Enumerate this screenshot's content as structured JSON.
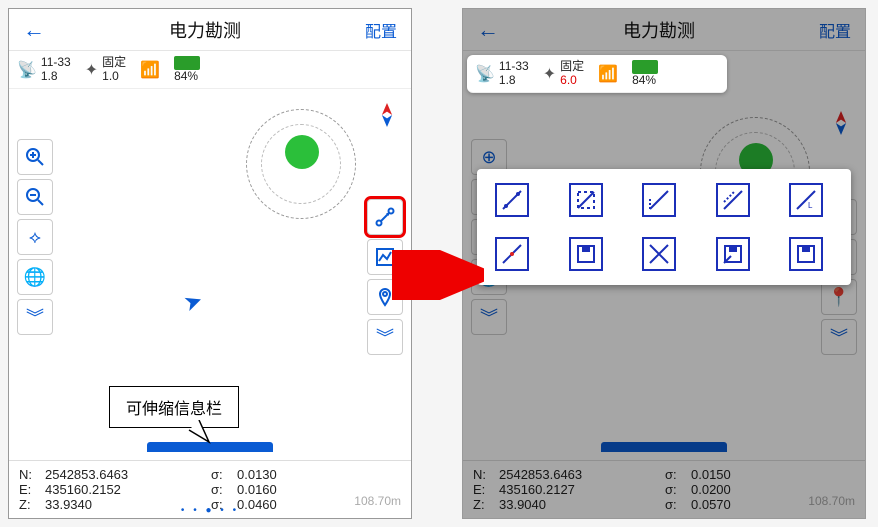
{
  "left": {
    "header": {
      "back": "←",
      "title": "电力勘测",
      "config": "配置"
    },
    "status": {
      "sat": {
        "top": "11-33",
        "bottom": "1.8"
      },
      "fix": {
        "label": "固定",
        "value": "1.0"
      },
      "batt": {
        "pct": "84%"
      }
    },
    "coords": {
      "N": "2542853.6463",
      "E": "435160.2152",
      "Z": "33.9340",
      "sN": "0.0130",
      "sE": "0.0160",
      "sZ": "0.0460"
    },
    "dist": "108.70m",
    "callout": "可伸缩信息栏"
  },
  "right": {
    "header": {
      "back": "←",
      "title": "电力勘测",
      "config": "配置"
    },
    "status": {
      "sat": {
        "top": "11-33",
        "bottom": "1.8"
      },
      "fix": {
        "label": "固定",
        "value": "6.0"
      },
      "batt": {
        "pct": "84%"
      }
    },
    "coords": {
      "N": "2542853.6463",
      "E": "435160.2127",
      "Z": "33.9040",
      "sN": "0.0150",
      "sE": "0.0200",
      "sZ": "0.0570"
    },
    "dist": "108.70m"
  },
  "tools_left": [
    "zoom-in",
    "zoom-out",
    "focus",
    "globe",
    "expand-down"
  ],
  "tools_right": [
    "measure",
    "chart",
    "pin",
    "expand-down"
  ],
  "popup_tools": [
    "offset-point",
    "offset-distance",
    "offset-angle",
    "offset-line",
    "offset-lat",
    "offset-red",
    "save-1",
    "intersect",
    "save-2",
    "save-3"
  ]
}
